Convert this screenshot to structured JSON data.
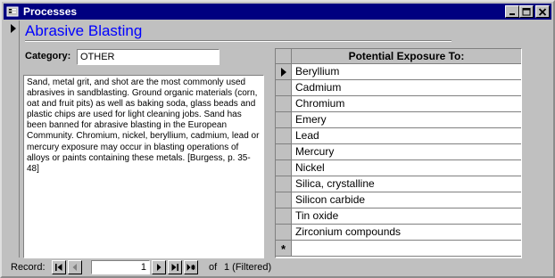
{
  "window": {
    "title": "Processes",
    "controls": [
      "minimize-icon",
      "maximize-icon",
      "close-icon"
    ]
  },
  "form": {
    "title": "Abrasive Blasting",
    "category_label": "Category:",
    "category_value": "OTHER",
    "description": "Sand, metal grit, and shot are the most commonly used abrasives in sandblasting. Ground organic materials (corn, oat and fruit pits) as well as baking soda, glass beads and plastic chips are used for light cleaning jobs.  Sand has been banned for abrasive blasting in the European Community. Chromium, nickel, beryllium, cadmium, lead or mercury exposure may occur in blasting operations of alloys or paints containing these metals. [Burgess, p. 35-48]"
  },
  "subform": {
    "header": "Potential Exposure To:",
    "rows": [
      "Beryllium",
      "Cadmium",
      "Chromium",
      "Emery",
      "Lead",
      "Mercury",
      "Nickel",
      "Silica, crystalline",
      "Silicon carbide",
      "Tin oxide",
      "Zirconium compounds"
    ],
    "new_record_symbol": "*"
  },
  "navigation": {
    "record_label": "Record:",
    "current_record": "1",
    "of_label": "of",
    "total": "1 (Filtered)"
  },
  "colors": {
    "title_bar": "#000080",
    "form_title": "#0000ff",
    "face": "#c0c0c0"
  }
}
